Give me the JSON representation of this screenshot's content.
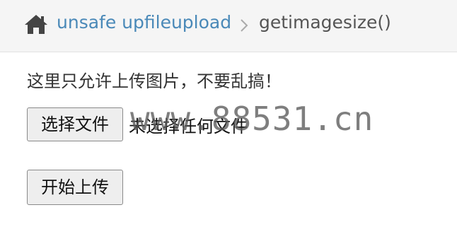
{
  "breadcrumb": {
    "home_icon": "home-icon",
    "section_label": "unsafe upfileupload",
    "separator_icon": "chevron-right-icon",
    "current_label": "getimagesize()"
  },
  "form": {
    "notice": "这里只允许上传图片，不要乱搞！",
    "file_button_label": "选择文件",
    "file_status": "未选择任何文件",
    "submit_label": "开始上传"
  },
  "watermark": "www.88531.cn",
  "colors": {
    "link": "#4a89b8",
    "breadcrumb_bg": "#f5f5f5"
  }
}
